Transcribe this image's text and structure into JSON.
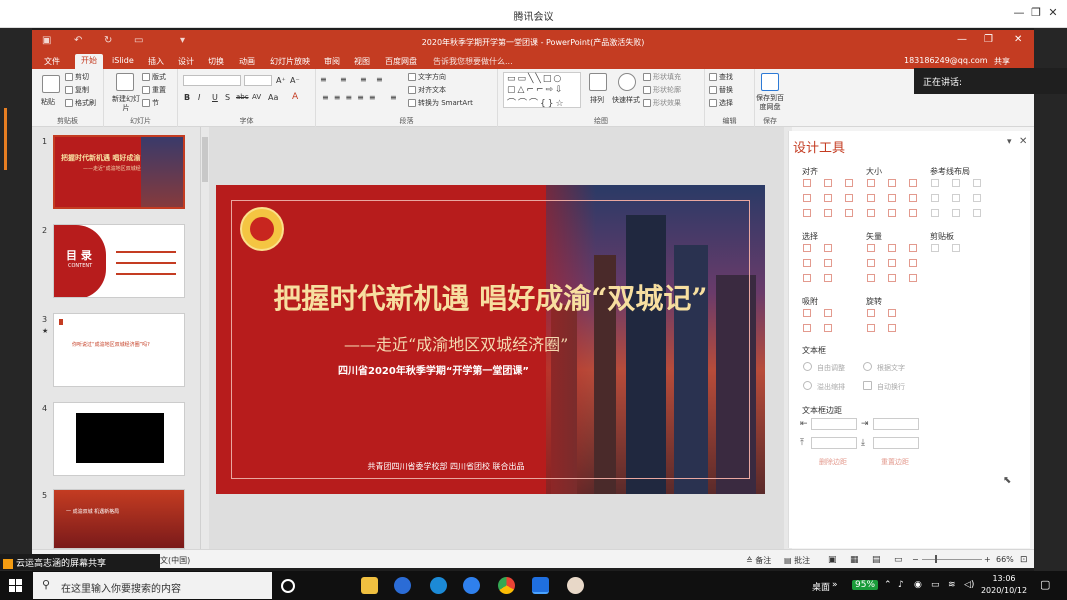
{
  "outer": {
    "title": "腾讯会议",
    "speaking_label": "正在讲话:",
    "share_label": "云运高志涵的屏幕共享"
  },
  "window_controls": {
    "minimize": "—",
    "restore": "❐",
    "close": "✕"
  },
  "ppt": {
    "doc_title": "2020年秋季学期开学第一堂团课 - PowerPoint(产品激活失败)",
    "tabs": [
      "文件",
      "开始",
      "iSlide",
      "插入",
      "设计",
      "切换",
      "动画",
      "幻灯片放映",
      "审阅",
      "视图",
      "百度网盘"
    ],
    "active_tab": "开始",
    "tell_me": "告诉我您想要做什么...",
    "account": "183186249@qq.com",
    "share": "共享",
    "ribbon": {
      "groups": [
        "剪贴板",
        "幻灯片",
        "字体",
        "段落",
        "绘图",
        "编辑",
        "保存"
      ],
      "paste": "粘贴",
      "cut": "剪切",
      "copy": "复制",
      "format_painter": "格式刷",
      "new_slide": "新建幻灯片",
      "layout": "版式",
      "reset": "重置",
      "section": "节",
      "text_direction": "文字方向",
      "align_text": "对齐文本",
      "smartart": "转换为 SmartArt",
      "arrange": "排列",
      "quick_styles": "快速样式",
      "shape_fill": "形状填充",
      "shape_outline": "形状轮廓",
      "shape_effects": "形状效果",
      "find": "查找",
      "replace": "替换",
      "select": "选择",
      "save_to_baidu": "保存到百度网盘",
      "font_buttons": [
        "B",
        "I",
        "U",
        "S",
        "abc",
        "AV",
        "Aa",
        "A"
      ],
      "para_buttons": [
        "≡",
        "≡",
        "≡",
        "≡",
        "≡"
      ]
    },
    "thumbnails": [
      {
        "num": "1",
        "title": "把握时代新机遇 唱好成渝“双城记”",
        "sub": "——走近“成渝地区双城经济圈”"
      },
      {
        "num": "2",
        "title": "目 录",
        "sub": "CONTENT"
      },
      {
        "num": "3",
        "title": "你听说过“成渝地区双城经济圈”吗?",
        "sub": ""
      },
      {
        "num": "4",
        "title": "",
        "sub": ""
      },
      {
        "num": "5",
        "title": "一  成渝双城   机遇新格局",
        "sub": ""
      }
    ],
    "slide": {
      "title": "把握时代新机遇 唱好成渝“双城记”",
      "subtitle": "——走近“成渝地区双城经济圈”",
      "subtitle2": "四川省2020年秋季学期“开学第一堂团课”",
      "footer": "共青团四川省委学校部   四川省团校  联合出品"
    },
    "design_panel": {
      "title": "设计工具",
      "sections": {
        "align": "对齐",
        "size": "大小",
        "guides": "参考线布局",
        "select": "选择",
        "vector": "矢量",
        "clipboard": "剪贴板",
        "snap": "吸附",
        "rotate": "旋转",
        "textbox": "文本框",
        "textbox_margin": "文本框边距"
      },
      "options": {
        "autofit": "自由调整",
        "fit_text": "根据文字",
        "overflow": "溢出缩排",
        "wrap": "自动换行",
        "remove_margin": "删除边距",
        "reset_margin": "重置边距"
      }
    },
    "status": {
      "lang": "中文(中国)",
      "notes": "备注",
      "comments": "批注",
      "zoom": "66%"
    }
  },
  "taskbar": {
    "search_placeholder": "在这里输入你要搜索的内容",
    "desktop": "桌面",
    "battery": "95%",
    "time": "13:06",
    "date": "2020/10/12",
    "icons": [
      "task-view-icon",
      "file-explorer-icon",
      "clock-app-icon",
      "edge-icon",
      "feishu-icon",
      "chrome-icon",
      "tencent-meeting-icon",
      "avatar-app-icon"
    ]
  },
  "colors": {
    "accent": "#c43c22",
    "slide_red": "#b71c1c",
    "gold": "#f7dfa0"
  }
}
